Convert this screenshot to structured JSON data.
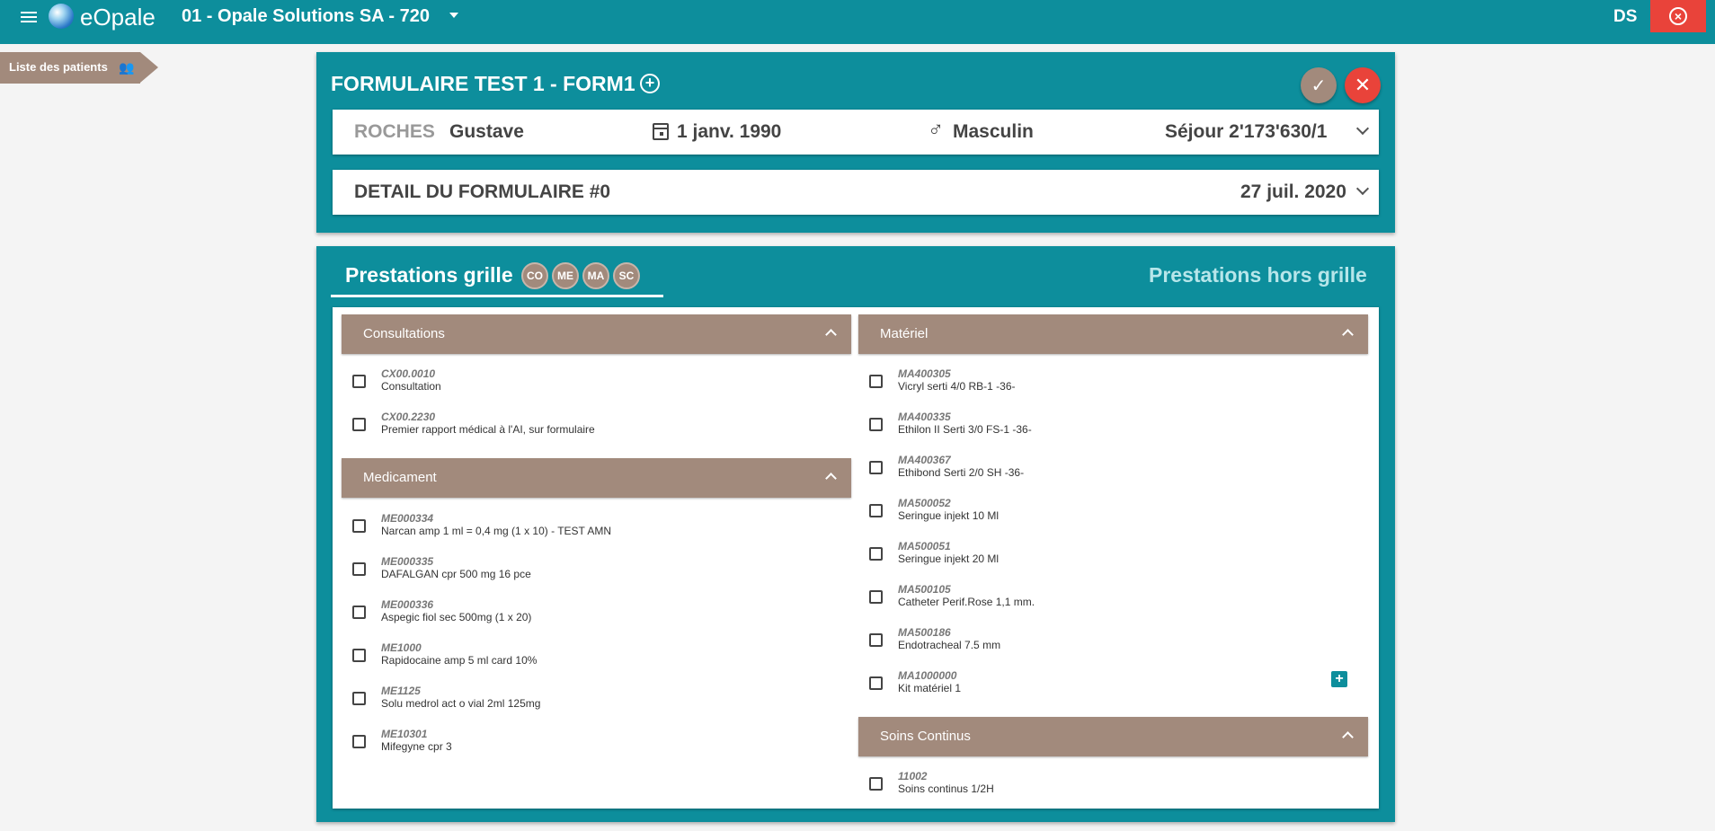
{
  "app": {
    "name": "eOpale",
    "organization": "01 - Opale Solutions SA - 720",
    "user_initials": "DS",
    "exit_symbol": "×"
  },
  "sidebar": {
    "patients_tab_label": "Liste des patients",
    "patients_icon": "👥"
  },
  "form": {
    "title": "FORMULAIRE TEST 1 - FORM1",
    "add_symbol": "+",
    "ok_symbol": "✓",
    "cancel_symbol": "✕"
  },
  "patient": {
    "last_name": "ROCHES",
    "first_name": "Gustave",
    "birth_date": "1 janv. 1990",
    "gender_symbol": "♂",
    "gender": "Masculin",
    "sejour": "Séjour 2'173'630/1"
  },
  "detail": {
    "title": "DETAIL DU FORMULAIRE #0",
    "date": "27 juil. 2020"
  },
  "tabs": {
    "grille": "Prestations grille",
    "hors_grille": "Prestations hors grille",
    "chips": [
      "CO",
      "ME",
      "MA",
      "SC"
    ]
  },
  "sections": {
    "consultations": {
      "title": "Consultations",
      "items": [
        {
          "code": "CX00.0010",
          "desc": "Consultation"
        },
        {
          "code": "CX00.2230",
          "desc": "Premier rapport médical à l'AI, sur formulaire"
        }
      ]
    },
    "medicament": {
      "title": "Medicament",
      "items": [
        {
          "code": "ME000334",
          "desc": "Narcan amp 1 ml = 0,4 mg (1 x 10) - TEST AMN"
        },
        {
          "code": "ME000335",
          "desc": "DAFALGAN cpr 500 mg 16 pce"
        },
        {
          "code": "ME000336",
          "desc": "Aspegic fiol sec 500mg (1 x 20)"
        },
        {
          "code": "ME1000",
          "desc": "Rapidocaine amp 5 ml card 10%"
        },
        {
          "code": "ME1125",
          "desc": "Solu medrol act o vial 2ml 125mg"
        },
        {
          "code": "ME10301",
          "desc": "Mifegyne cpr 3"
        }
      ]
    },
    "materiel": {
      "title": "Matériel",
      "items": [
        {
          "code": "MA400305",
          "desc": "Vicryl serti 4/0 RB-1 -36-"
        },
        {
          "code": "MA400335",
          "desc": "Ethilon II Serti 3/0 FS-1 -36-"
        },
        {
          "code": "MA400367",
          "desc": "Ethibond Serti 2/0 SH -36-"
        },
        {
          "code": "MA500052",
          "desc": "Seringue injekt 10 Ml"
        },
        {
          "code": "MA500051",
          "desc": "Seringue injekt 20 Ml"
        },
        {
          "code": "MA500105",
          "desc": "Catheter Perif.Rose 1,1 mm."
        },
        {
          "code": "MA500186",
          "desc": "Endotracheal 7.5 mm"
        },
        {
          "code": "MA1000000",
          "desc": "Kit matériel 1"
        }
      ],
      "plus_symbol": "+"
    },
    "soins": {
      "title": "Soins Continus",
      "items": [
        {
          "code": "11002",
          "desc": "Soins continus 1/2H"
        }
      ]
    }
  },
  "colors": {
    "primary": "#0d8e9c",
    "secondary": "#a28a7c",
    "danger": "#e9433a"
  }
}
